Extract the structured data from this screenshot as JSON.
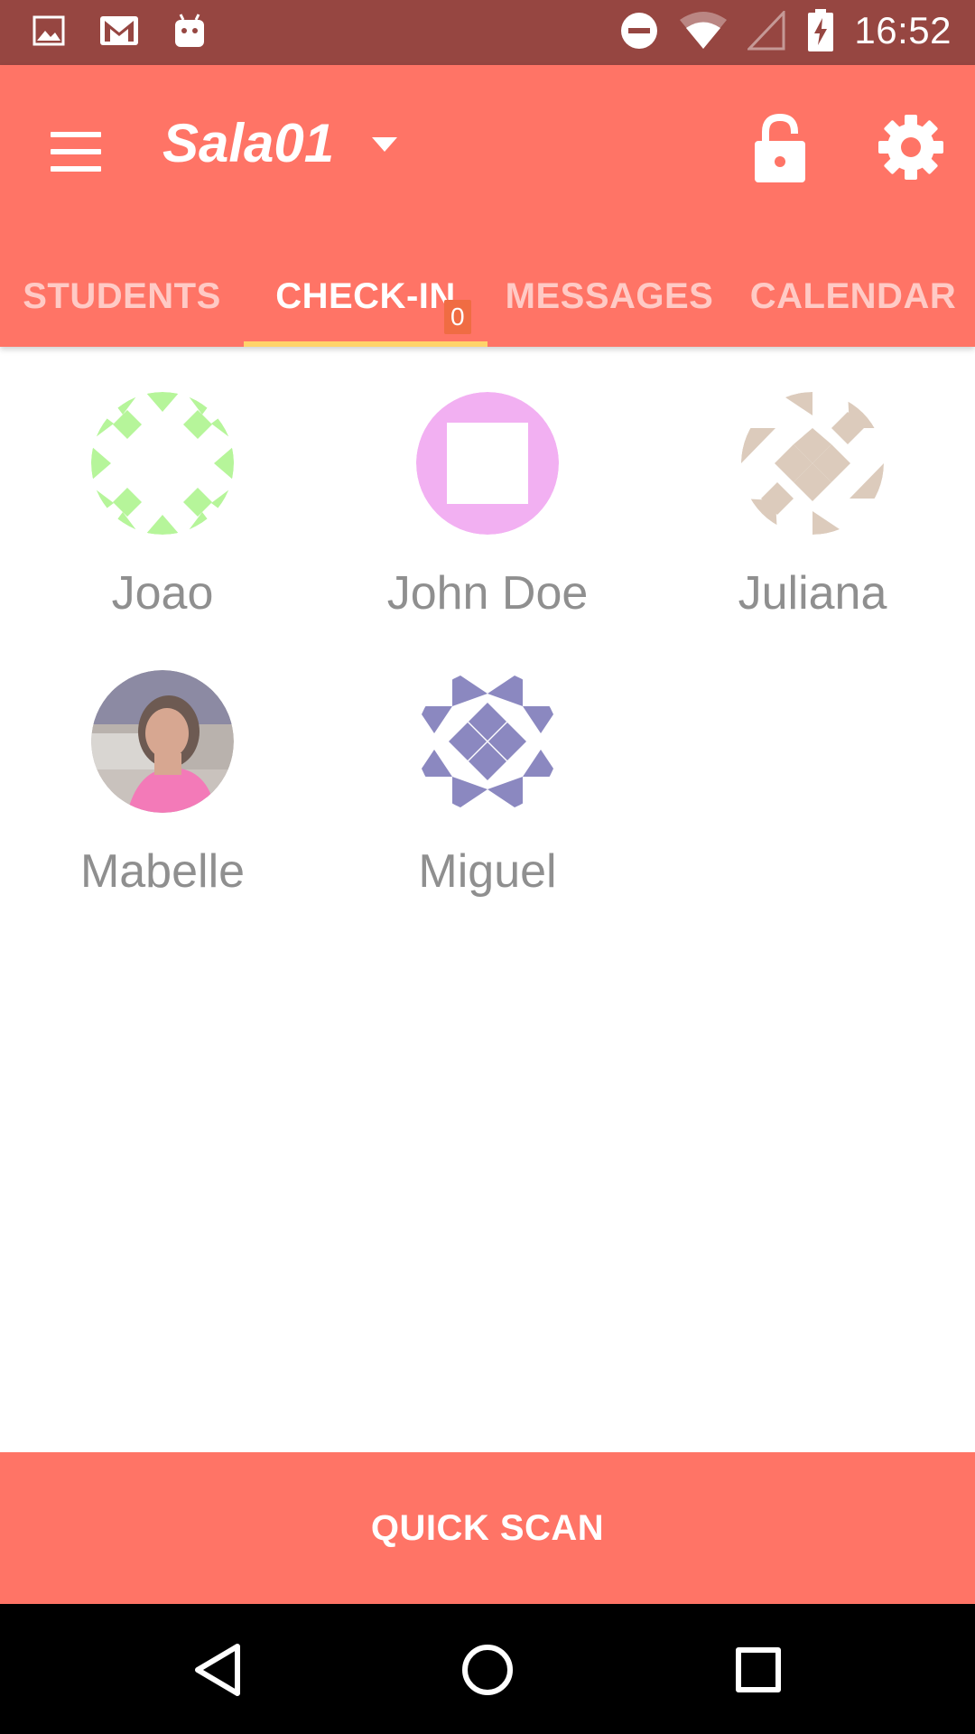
{
  "status_bar": {
    "time": "16:52",
    "icons": [
      "image-icon",
      "gmail-icon",
      "android-icon",
      "do-not-disturb-icon",
      "wifi-icon",
      "cell-signal-icon",
      "battery-charging-icon"
    ]
  },
  "app_bar": {
    "title": "Sala01",
    "background_color": "#ff7466"
  },
  "tabs": [
    {
      "label": "STUDENTS",
      "active": false
    },
    {
      "label": "CHECK-IN",
      "active": true,
      "badge": "0"
    },
    {
      "label": "MESSAGES",
      "active": false
    },
    {
      "label": "CALENDAR",
      "active": false
    }
  ],
  "students": [
    {
      "name": "Joao",
      "avatar": "identicon-green",
      "color": "#b6f59a"
    },
    {
      "name": "John Doe",
      "avatar": "identicon-pink",
      "color": "#f2b0f2"
    },
    {
      "name": "Juliana",
      "avatar": "identicon-tan",
      "color": "#dccbbc"
    },
    {
      "name": "Mabelle",
      "avatar": "photo"
    },
    {
      "name": "Miguel",
      "avatar": "identicon-purple",
      "color": "#8b88c0"
    }
  ],
  "quick_scan": {
    "label": "QUICK SCAN"
  },
  "nav_bar": {
    "icons": [
      "back-icon",
      "home-icon",
      "recents-icon"
    ]
  }
}
